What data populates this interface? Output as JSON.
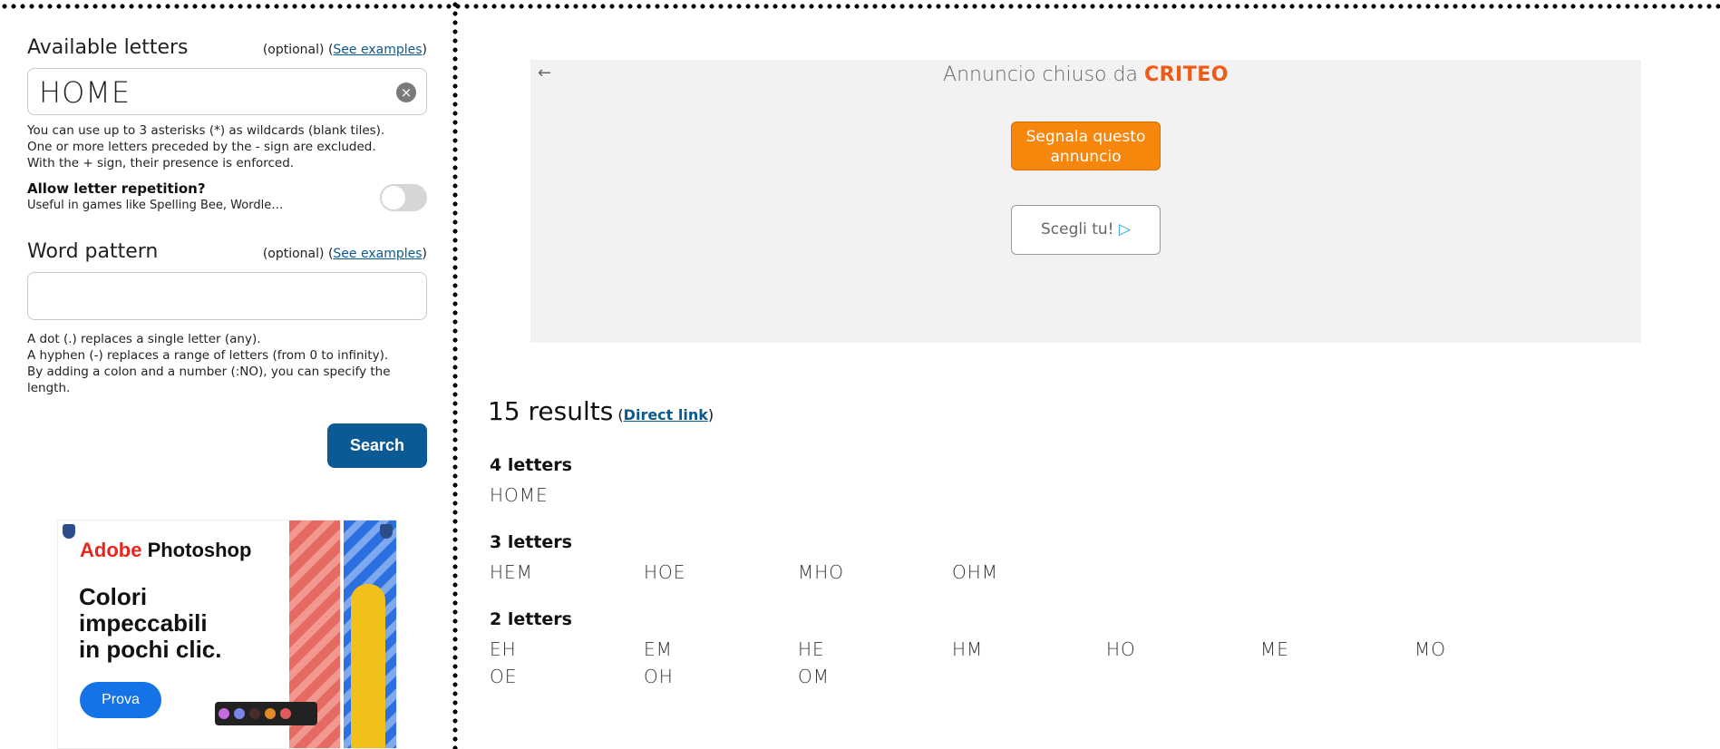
{
  "letters_section": {
    "title": "Available letters",
    "optional": "(optional) (",
    "examples_link": "See examples",
    "close_paren": ")",
    "value": "HOME",
    "clear_icon": "×",
    "help_line1": "You can use up to 3 asterisks (*) as wildcards (blank tiles).",
    "help_line2": "One or more letters preceded by the - sign are excluded.",
    "help_line3": "With the + sign, their presence is enforced."
  },
  "repetition": {
    "title": "Allow letter repetition?",
    "subtitle": "Useful in games like Spelling Bee, Wordle…",
    "enabled": false
  },
  "pattern_section": {
    "title": "Word pattern",
    "optional": "(optional) (",
    "examples_link": "See examples",
    "close_paren": ")",
    "value": "",
    "help_line1": "A dot (.) replaces a single letter (any).",
    "help_line2": "A hyphen (-) replaces a range of letters (from 0 to infinity).",
    "help_line3": "By adding a colon and a number (:NO), you can specify the length."
  },
  "search_button": "Search",
  "left_ad": {
    "brand_adobe": "Adobe",
    "brand_product": " Photoshop",
    "headline_line1": "Colori",
    "headline_line2": "impeccabili",
    "headline_line3": "in pochi clic.",
    "button": "Prova"
  },
  "right_ad": {
    "back_icon": "←",
    "closed_text": "Annuncio chiuso da ",
    "criteo": "CRITEO",
    "report_button": "Segnala questo annuncio",
    "choose_button": "Scegli tu!",
    "choose_icon": "▷"
  },
  "results": {
    "count_label": "15 results",
    "open_paren": " (",
    "direct_link": "Direct link",
    "close_paren": ")",
    "groups": [
      {
        "title": "4 letters",
        "words": [
          "HOME"
        ]
      },
      {
        "title": "3 letters",
        "words": [
          "HEM",
          "HOE",
          "MHO",
          "OHM"
        ]
      },
      {
        "title": "2 letters",
        "words": [
          "EH",
          "EM",
          "HE",
          "HM",
          "HO",
          "ME",
          "MO",
          "OE",
          "OH",
          "OM"
        ]
      }
    ]
  },
  "colors": {
    "search_button": "#0b5a95",
    "report_button": "#f7860c",
    "criteo": "#f05a14",
    "link": "#0b5a8f"
  }
}
